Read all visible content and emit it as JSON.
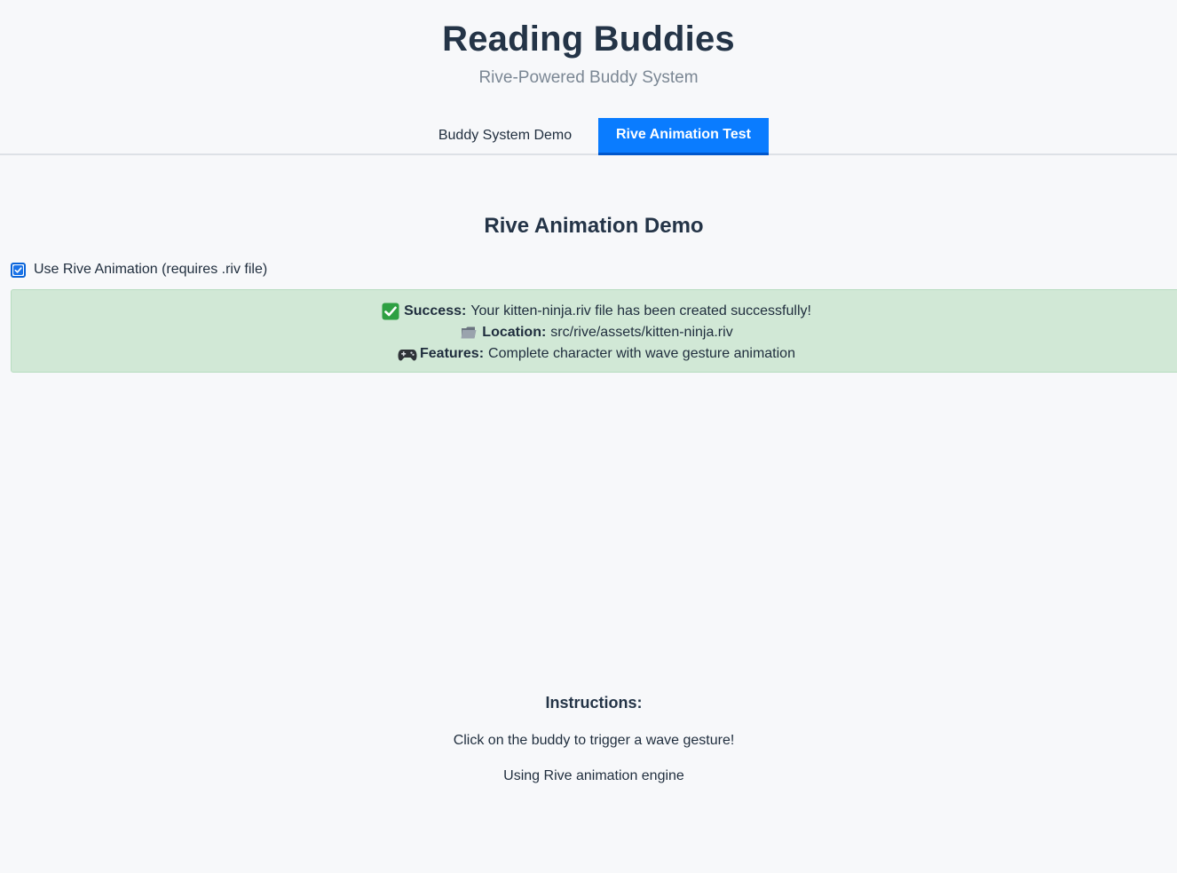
{
  "header": {
    "title": "Reading Buddies",
    "subtitle": "Rive-Powered Buddy System"
  },
  "tabs": [
    {
      "label": "Buddy System Demo",
      "active": false
    },
    {
      "label": "Rive Animation Test",
      "active": true
    }
  ],
  "section": {
    "title": "Rive Animation Demo"
  },
  "toggle": {
    "label": "Use Rive Animation (requires .riv file)",
    "checked": true
  },
  "status": {
    "success_label": "Success:",
    "success_text": "Your kitten-ninja.riv file has been created successfully!",
    "location_label": "Location:",
    "location_text": "src/rive/assets/kitten-ninja.riv",
    "features_label": "Features:",
    "features_text": "Complete character with wave gesture animation"
  },
  "instructions": {
    "title": "Instructions:",
    "line1": "Click on the buddy to trigger a wave gesture!",
    "line2": "Using Rive animation engine"
  },
  "colors": {
    "accent": "#0a7cff",
    "success_bg": "#d1e8d6",
    "background": "#f7f8fa"
  },
  "icons": {
    "success": "check-mark-icon",
    "location": "folder-icon",
    "features": "game-controller-icon"
  }
}
